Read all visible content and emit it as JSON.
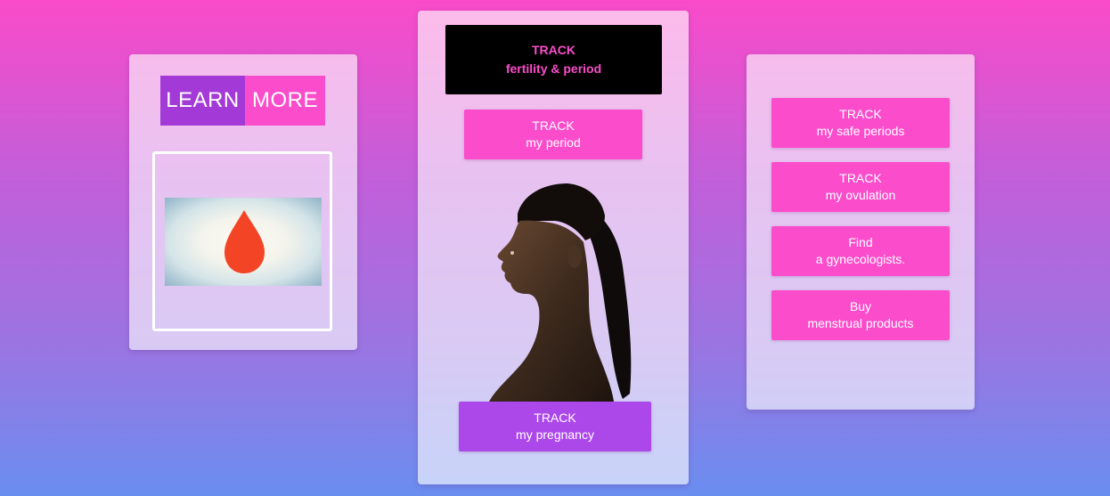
{
  "left_card": {
    "learn": "LEARN",
    "more": "MORE"
  },
  "middle_card": {
    "track_main": {
      "line1": "TRACK",
      "line2": "fertility & period"
    },
    "track_period": {
      "line1": "TRACK",
      "line2": "my period"
    },
    "track_pregnancy": {
      "line1": "TRACK",
      "line2": "my pregnancy"
    }
  },
  "right_card": {
    "buttons": [
      {
        "line1": "TRACK",
        "line2": "my safe periods"
      },
      {
        "line1": "TRACK",
        "line2": "my ovulation"
      },
      {
        "line1": "Find",
        "line2": "a gynecologists."
      },
      {
        "line1": "Buy",
        "line2": "menstrual products"
      }
    ]
  },
  "colors": {
    "pink": "#fb4dcb",
    "purple": "#a33ad8",
    "pregnancy_purple": "#ac48ea",
    "black": "#000000",
    "drop_red": "#f44426"
  },
  "icons": {
    "drop": "blood-drop-icon",
    "portrait": "woman-profile-portrait"
  }
}
